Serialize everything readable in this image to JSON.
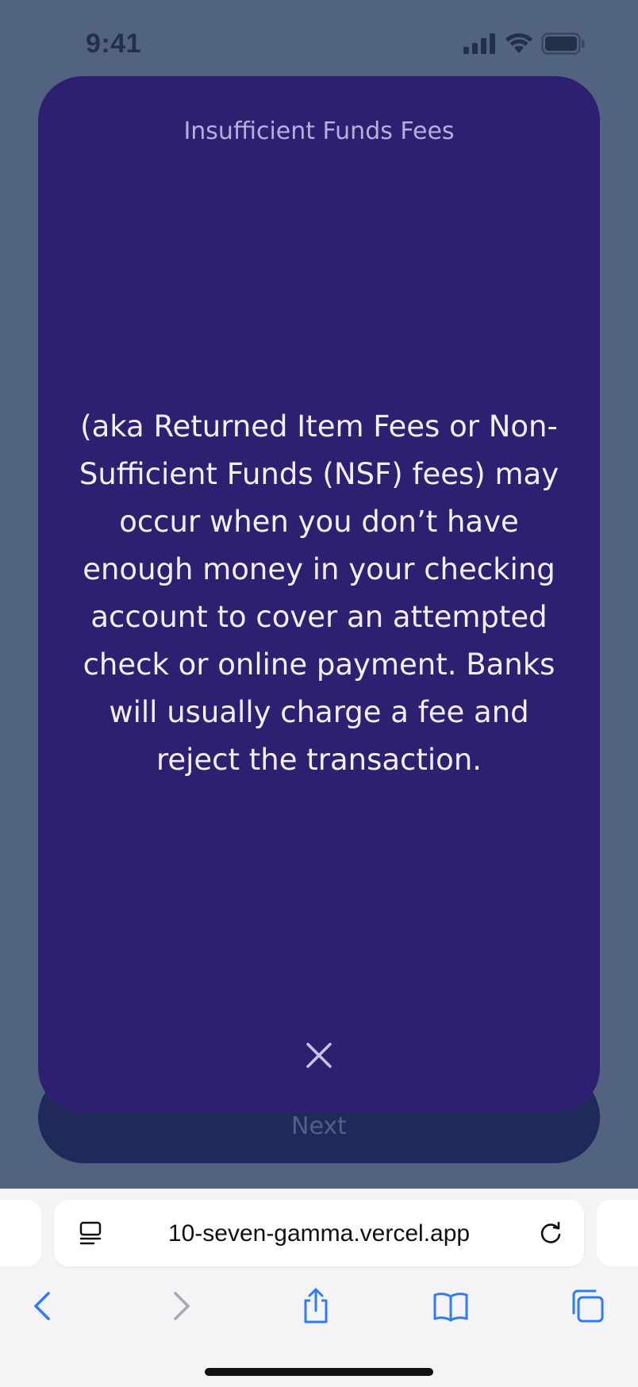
{
  "status_bar": {
    "time": "9:41"
  },
  "modal": {
    "title": "Insufficient Funds Fees",
    "body": "(aka Returned Item Fees or Non-Sufficient Funds (NSF) fees) may occur when you don’t have enough money in your checking account to cover an attempted check or online payment. Banks will usually charge a fee and reject the transaction.",
    "close_icon": "close-icon"
  },
  "next_button": {
    "label": "Next"
  },
  "browser": {
    "url": "10-seven-gamma.vercel.app",
    "icons": {
      "reader": "reader-mode-icon",
      "reload": "reload-icon",
      "back": "chevron-left-icon",
      "forward": "chevron-right-icon",
      "share": "share-icon",
      "bookmarks": "book-icon",
      "tabs": "tabs-icon"
    }
  },
  "colors": {
    "page_background": "#52637f",
    "modal_background": "#2e2070",
    "next_button_background": "#1f2a5b",
    "browser_accent": "#2f7cf6"
  }
}
